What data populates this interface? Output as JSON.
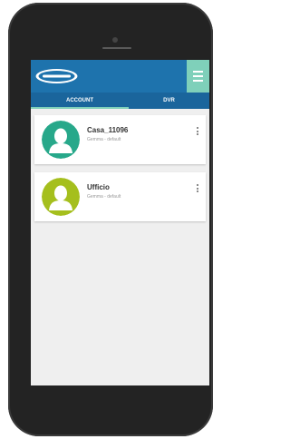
{
  "app": {
    "brand_colors": {
      "appbar": "#1e73ad",
      "tabbar": "#1a659c",
      "accent": "#7fd0ba"
    },
    "logo_icon": "brand-logo-icon",
    "menu_icon": "hamburger-menu-icon"
  },
  "tabs": [
    {
      "label": "ACCOUNT",
      "selected": true
    },
    {
      "label": "DVR",
      "selected": false
    }
  ],
  "accounts": [
    {
      "name": "Casa_11096",
      "subtitle": "Gemma - default",
      "avatar_color": "#27a88a",
      "avatar_icon": "user-avatar-icon",
      "menu_icon": "more-vert-icon"
    },
    {
      "name": "Ufficio",
      "subtitle": "Gemma - default",
      "avatar_color": "#a5bf1d",
      "avatar_icon": "user-avatar-icon",
      "menu_icon": "more-vert-icon"
    }
  ]
}
